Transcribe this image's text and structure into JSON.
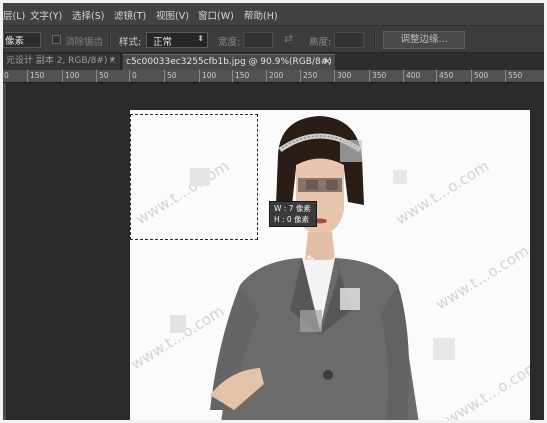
{
  "menu": {
    "items": [
      "层(L)",
      "文字(Y)",
      "选择(S)",
      "滤镜(T)",
      "视图(V)",
      "窗口(W)",
      "帮助(H)"
    ]
  },
  "options": {
    "feather_unit": "像素",
    "anti_alias_label": "消除锯齿",
    "style_label": "样式:",
    "style_value": "正常",
    "width_label": "宽度:",
    "height_label": "高度:",
    "refine_edge_label": "调整边缘..."
  },
  "tabs": [
    {
      "label": "元设计 副本 2, RGB/8#) *",
      "close": "×"
    },
    {
      "label": "c5c00033ec3255cfb1b.jpg @ 90.9%(RGB/8#)",
      "close": "×"
    }
  ],
  "ruler": {
    "labels": [
      "0",
      "150",
      "100",
      "50",
      "0",
      "50",
      "100",
      "150",
      "200",
      "250",
      "300",
      "350",
      "400",
      "450",
      "500",
      "550"
    ]
  },
  "tooltip": {
    "w_line": "W : 7 像素",
    "h_line": "H : 0 像素"
  },
  "canvas": {
    "watermark": "www.t...o.com"
  },
  "colors": {
    "menu_bg": "#424242",
    "options_bg": "#3c3c3c",
    "workspace_bg": "#2a2a2a",
    "canvas_bg": "#fafafa",
    "jacket": "#6b6b6b"
  }
}
